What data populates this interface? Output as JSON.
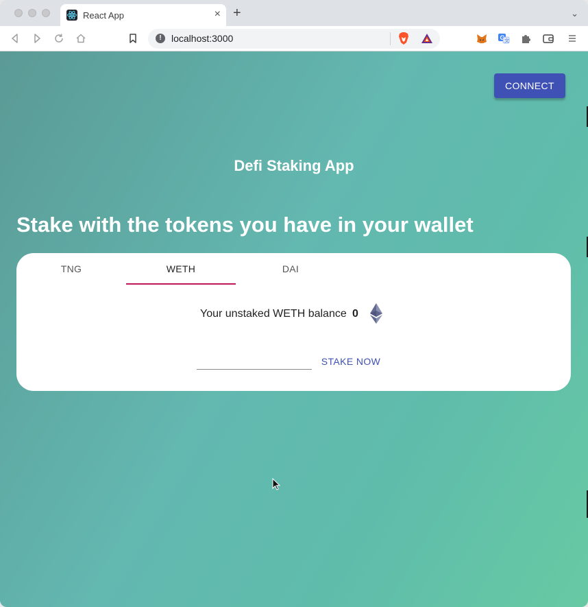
{
  "browser": {
    "tab_title": "React App",
    "tab_close": "×",
    "new_tab": "+",
    "tab_menu": "⌄",
    "url": "localhost:3000"
  },
  "header": {
    "connect_label": "CONNECT"
  },
  "main": {
    "app_title": "Defi Staking App",
    "headline": "Stake with the tokens you have in your wallet"
  },
  "tabs": [
    {
      "label": "TNG",
      "active": false
    },
    {
      "label": "WETH",
      "active": true
    },
    {
      "label": "DAI",
      "active": false
    }
  ],
  "staking": {
    "balance_label": "Your unstaked WETH balance",
    "balance_value": "0",
    "amount_value": "",
    "stake_label": "STAKE NOW"
  },
  "colors": {
    "primary": "#3f51b5",
    "tab_indicator": "#c2185b",
    "background_gradient_start": "#5b9a96",
    "background_gradient_end": "#67c9a3"
  },
  "icons": [
    "react-favicon",
    "back-icon",
    "forward-icon",
    "reload-icon",
    "home-icon",
    "bookmark-icon",
    "info-icon",
    "brave-shield-icon",
    "bat-rewards-icon",
    "metamask-icon",
    "translate-icon",
    "extensions-icon",
    "wallet-icon",
    "menu-icon",
    "ethereum-icon",
    "mouse-cursor-icon"
  ]
}
